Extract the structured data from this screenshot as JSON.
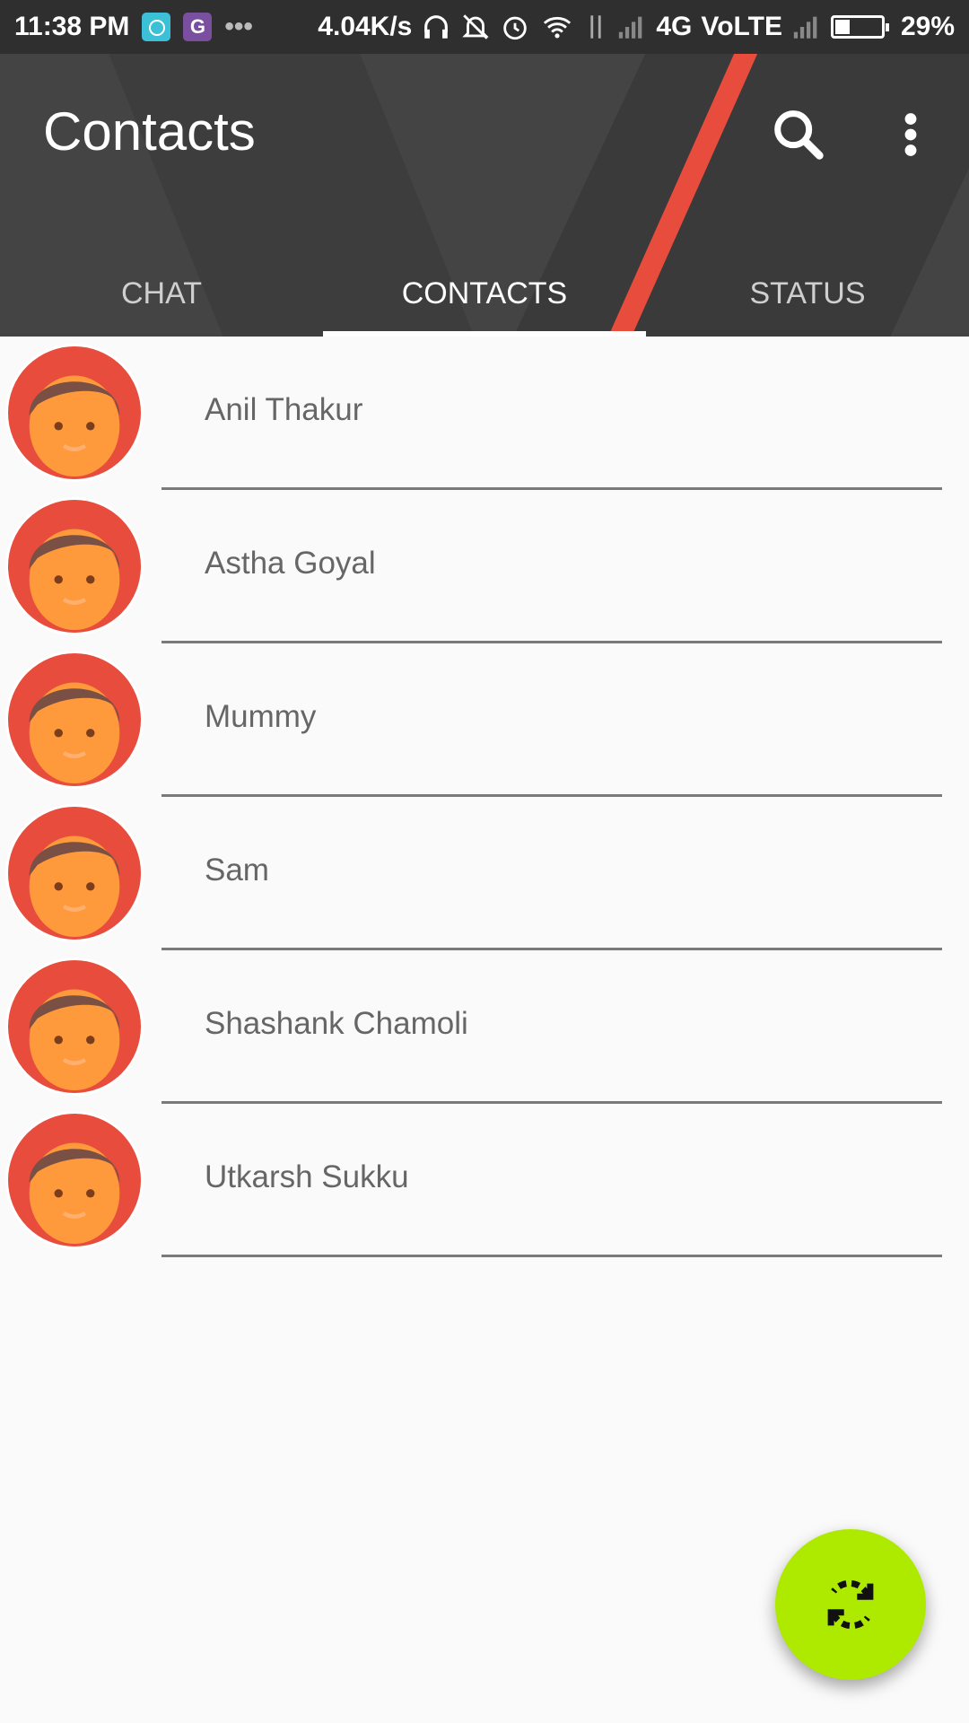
{
  "status_bar": {
    "time": "11:38 PM",
    "more_dots": "•••",
    "speed": "4.04K/s",
    "network": "4G",
    "volte": "VoLTE",
    "battery_text": "29%",
    "battery_level": 0.29
  },
  "app_bar": {
    "title": "Contacts"
  },
  "tabs": [
    {
      "label": "CHAT",
      "active": false
    },
    {
      "label": "CONTACTS",
      "active": true
    },
    {
      "label": "STATUS",
      "active": false
    }
  ],
  "contacts": [
    {
      "name": "Anil Thakur"
    },
    {
      "name": "Astha Goyal"
    },
    {
      "name": "Mummy"
    },
    {
      "name": "Sam"
    },
    {
      "name": "Shashank Chamoli"
    },
    {
      "name": "Utkarsh Sukku"
    }
  ],
  "fab": {
    "icon": "refresh-icon",
    "color": "#aeea00"
  },
  "colors": {
    "accent": "#e74c3c",
    "app_bar": "#444444",
    "avatar_bg": "#e74c3c",
    "avatar_face": "#ff9a3c",
    "avatar_hair": "#7b5044"
  }
}
